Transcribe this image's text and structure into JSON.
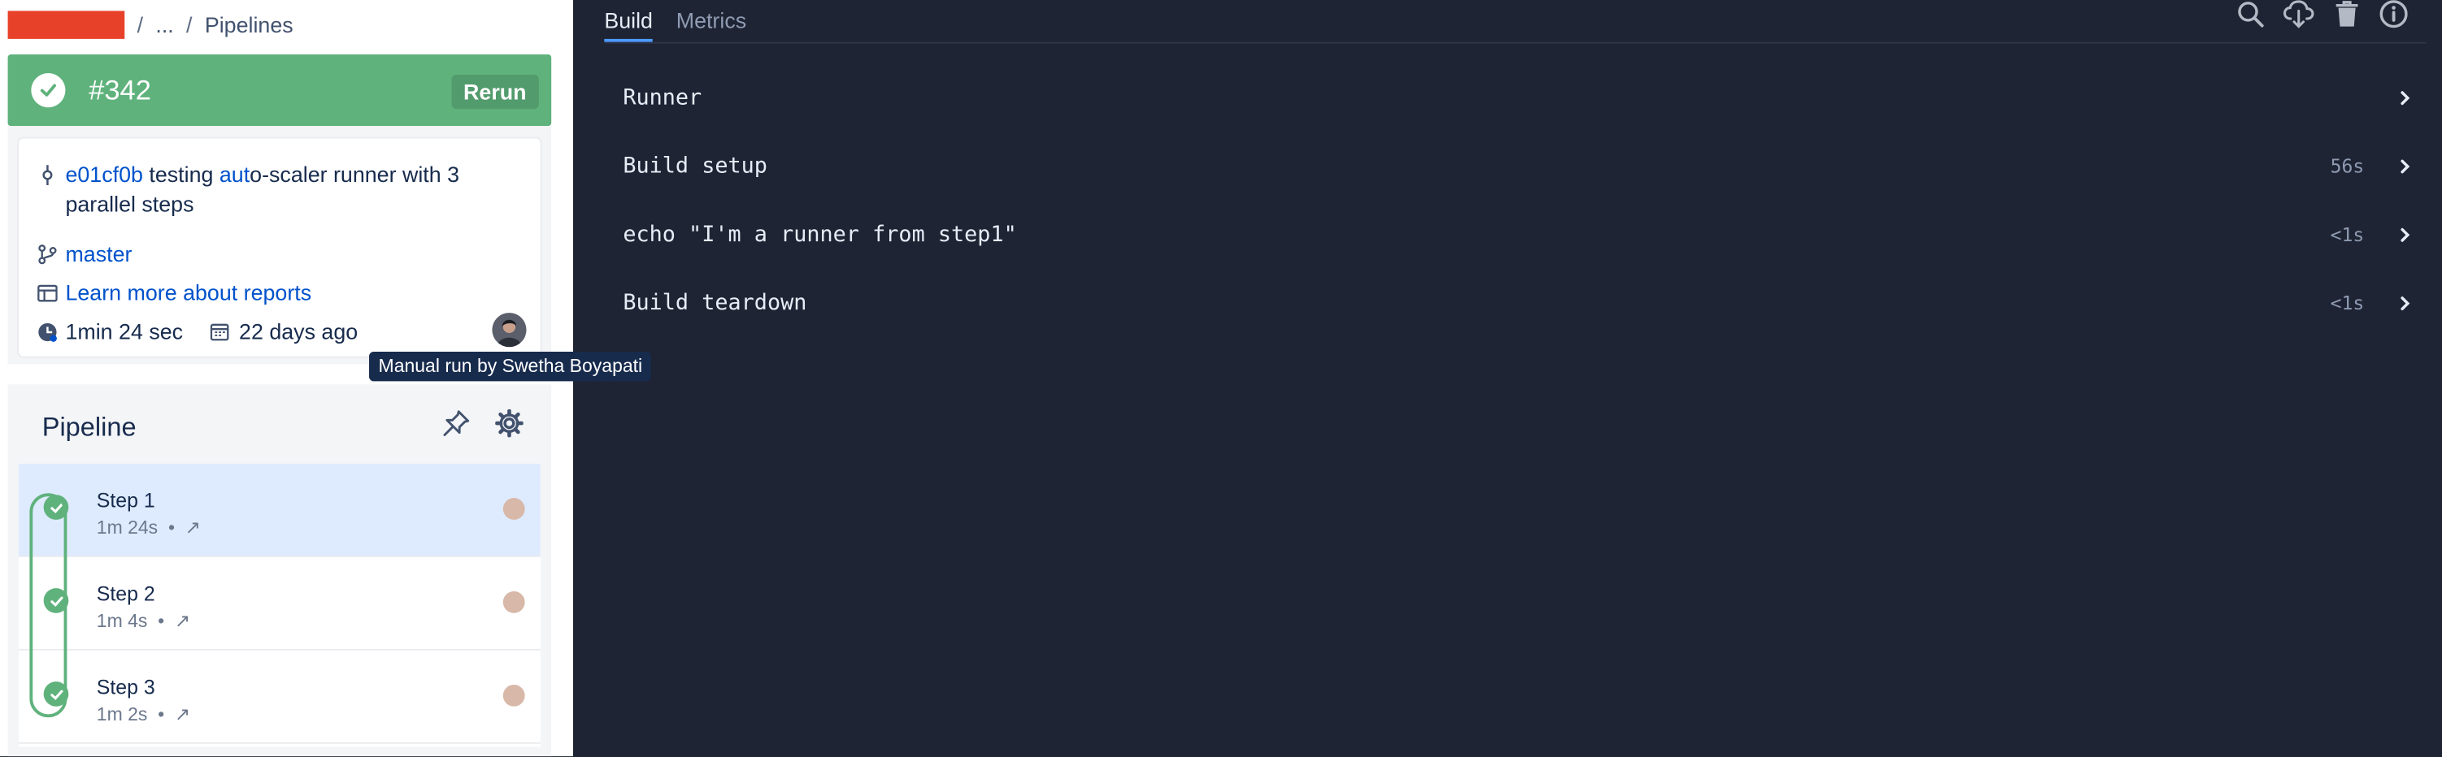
{
  "breadcrumb": {
    "ellipsis": "...",
    "sep": "/",
    "current": "Pipelines"
  },
  "status": {
    "build_number": "#342",
    "rerun_label": "Rerun",
    "color": "#5fb27c"
  },
  "info": {
    "commit_hash": "e01cf0b",
    "commit_msg_pre": " testing ",
    "commit_msg_link": "aut",
    "commit_msg_post": "o-scaler runner with 3 parallel steps",
    "branch": "master",
    "reports_link": "Learn more about reports",
    "duration": "1min 24 sec",
    "age": "22 days ago"
  },
  "tooltip": "Manual run by Swetha Boyapati",
  "pipeline": {
    "title": "Pipeline",
    "steps": [
      {
        "name": "Step 1",
        "duration": "1m 24s",
        "dot": "•",
        "arrow": "↗"
      },
      {
        "name": "Step 2",
        "duration": "1m 4s",
        "dot": "•",
        "arrow": "↗"
      },
      {
        "name": "Step 3",
        "duration": "1m 2s",
        "dot": "•",
        "arrow": "↗"
      }
    ]
  },
  "tabs": {
    "build": "Build",
    "metrics": "Metrics"
  },
  "log": [
    {
      "label": "Runner",
      "duration": ""
    },
    {
      "label": "Build setup",
      "duration": "56s"
    },
    {
      "label": "echo \"I'm a runner from step1\"",
      "duration": "<1s"
    },
    {
      "label": "Build teardown",
      "duration": "<1s"
    }
  ]
}
